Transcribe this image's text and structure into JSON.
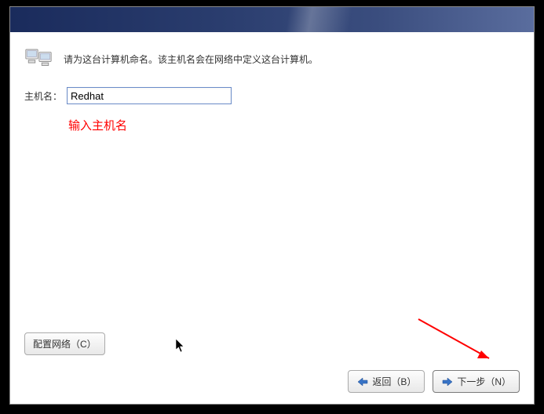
{
  "instruction": "请为这台计算机命名。该主机名会在网络中定义这台计算机。",
  "hostname": {
    "label": "主机名：",
    "value": "Redhat"
  },
  "annotation": "输入主机名",
  "buttons": {
    "config_network": "配置网络（C）",
    "back": "返回（B）",
    "next": "下一步（N）"
  },
  "icons": {
    "computer": "computer-icon",
    "arrow_left": "arrow-left-icon",
    "arrow_right": "arrow-right-icon",
    "cursor": "cursor-icon"
  }
}
